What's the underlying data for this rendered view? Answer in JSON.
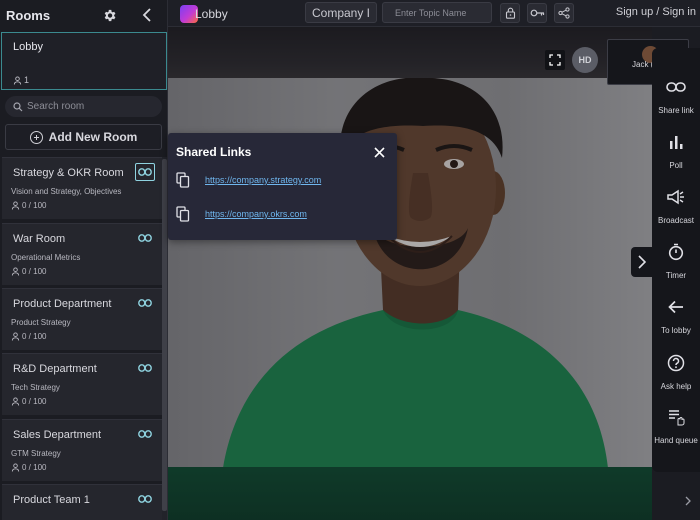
{
  "app": {
    "brand": "Lobby",
    "company": "Company I",
    "topic_placeholder": "Enter Topic Name",
    "auth_link": "Sign up / Sign in"
  },
  "sidebar": {
    "title": "Rooms",
    "lobby": {
      "name": "Lobby",
      "count": "1"
    },
    "search_placeholder": "Search room",
    "add_room_label": "Add New Room",
    "rooms": [
      {
        "name": "Strategy & OKR Room",
        "description": "Vision and Strategy, Objectives",
        "count": "0 / 100"
      },
      {
        "name": "War Room",
        "description": "Operational Metrics",
        "count": "0 / 100"
      },
      {
        "name": "Product Department",
        "description": "Product Strategy",
        "count": "0 / 100"
      },
      {
        "name": "R&D Department",
        "description": "Tech Strategy",
        "count": "0 / 100"
      },
      {
        "name": "Sales Department",
        "description": "GTM Strategy",
        "count": "0 / 100"
      },
      {
        "name": "Product Team 1",
        "description": "",
        "count": ""
      }
    ]
  },
  "video": {
    "hd_badge": "HD",
    "self_name": "Jack ("
  },
  "shared_links": {
    "title": "Shared Links",
    "links": [
      "https://company.strategy.com",
      "https://company.okrs.com"
    ]
  },
  "rail": {
    "items": [
      {
        "label": "Share link",
        "icon": "link-icon"
      },
      {
        "label": "Poll",
        "icon": "bar-chart-icon"
      },
      {
        "label": "Broadcast",
        "icon": "megaphone-icon"
      },
      {
        "label": "Timer",
        "icon": "stopwatch-icon"
      },
      {
        "label": "To lobby",
        "icon": "arrow-left-icon"
      },
      {
        "label": "Ask help",
        "icon": "question-icon"
      },
      {
        "label": "Hand queue",
        "icon": "hand-queue-icon"
      }
    ]
  },
  "colors": {
    "accent": "#3b8a8f",
    "link": "#6fb6ee",
    "panel": "#272838",
    "rail": "#15161b",
    "shirt": "#1b8a50"
  }
}
